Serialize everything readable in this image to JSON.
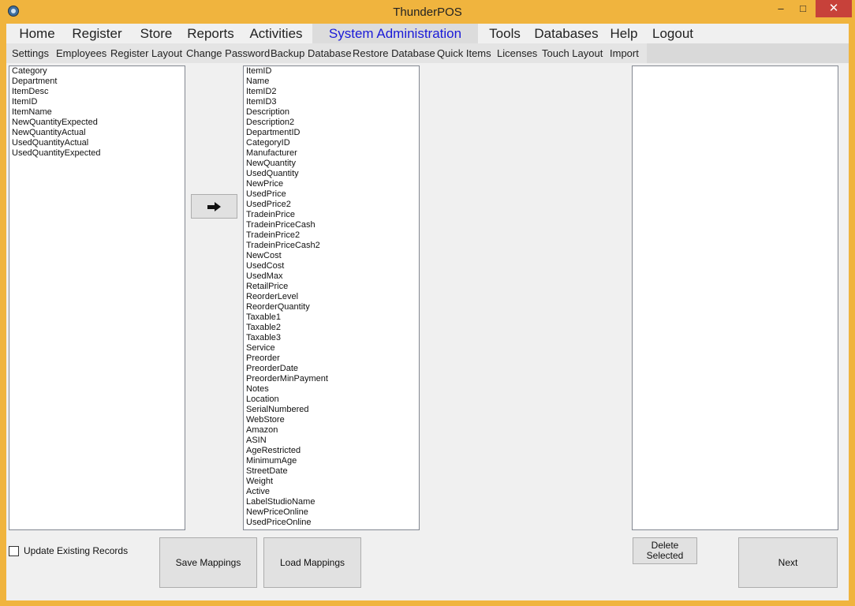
{
  "window": {
    "title": "ThunderPOS",
    "min_glyph": "–",
    "max_glyph": "□",
    "close_glyph": "✕"
  },
  "menu": [
    {
      "label": "Home"
    },
    {
      "label": "Register"
    },
    {
      "label": "Store"
    },
    {
      "label": "Reports"
    },
    {
      "label": "Activities"
    },
    {
      "label": "System Administration",
      "active": true
    },
    {
      "label": "Tools"
    },
    {
      "label": "Databases"
    },
    {
      "label": "Help"
    },
    {
      "label": "Logout"
    }
  ],
  "submenu": [
    {
      "label": "Settings"
    },
    {
      "label": "Employees"
    },
    {
      "label": "Register Layout"
    },
    {
      "label": "Change Password"
    },
    {
      "label": "Backup Database"
    },
    {
      "label": "Restore Database"
    },
    {
      "label": "Quick Items"
    },
    {
      "label": "Licenses"
    },
    {
      "label": "Touch Layout"
    },
    {
      "label": "Import"
    }
  ],
  "source_fields": [
    "Category",
    "Department",
    "ItemDesc",
    "ItemID",
    "ItemName",
    "NewQuantityExpected",
    "NewQuantityActual",
    "UsedQuantityActual",
    "UsedQuantityExpected"
  ],
  "target_fields": [
    "ItemID",
    "Name",
    "ItemID2",
    "ItemID3",
    "Description",
    "Description2",
    "DepartmentID",
    "CategoryID",
    "Manufacturer",
    "NewQuantity",
    "UsedQuantity",
    "NewPrice",
    "UsedPrice",
    "UsedPrice2",
    "TradeinPrice",
    "TradeinPriceCash",
    "TradeinPrice2",
    "TradeinPriceCash2",
    "NewCost",
    "UsedCost",
    "UsedMax",
    "RetailPrice",
    "ReorderLevel",
    "ReorderQuantity",
    "Taxable1",
    "Taxable2",
    "Taxable3",
    "Service",
    "Preorder",
    "PreorderDate",
    "PreorderMinPayment",
    "Notes",
    "Location",
    "SerialNumbered",
    "WebStore",
    "Amazon",
    "ASIN",
    "AgeRestricted",
    "MinimumAge",
    "StreetDate",
    "Weight",
    "Active",
    "LabelStudioName",
    "NewPriceOnline",
    "UsedPriceOnline"
  ],
  "mappings": [],
  "controls": {
    "update_existing_label": "Update Existing Records",
    "update_existing_checked": false,
    "save_mappings_label": "Save Mappings",
    "load_mappings_label": "Load Mappings",
    "delete_selected_line1": "Delete",
    "delete_selected_line2": "Selected",
    "next_label": "Next",
    "map_arrow_icon": "right-arrow-icon"
  }
}
